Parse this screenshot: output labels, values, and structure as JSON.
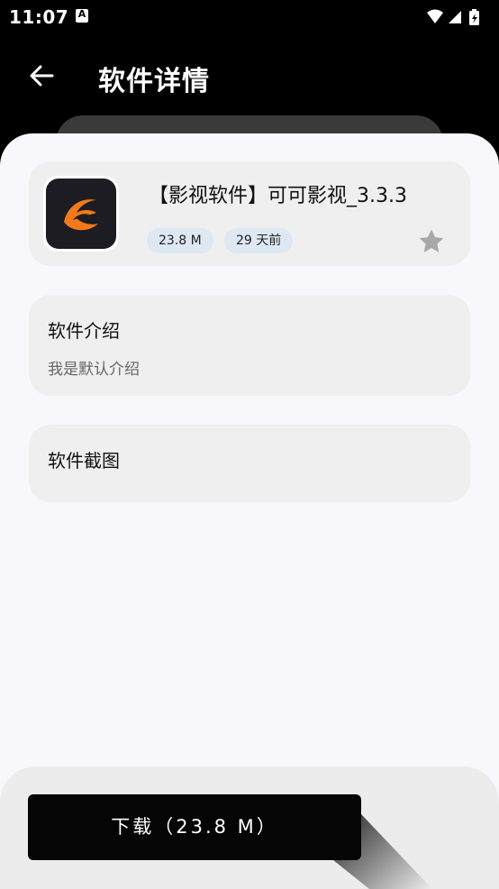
{
  "status_bar": {
    "time": "11:07",
    "notification_icon_letter": "A",
    "icons": [
      "wifi-icon",
      "signal-icon",
      "battery-charging-icon"
    ]
  },
  "header": {
    "title": "软件详情",
    "back_icon": "arrow-left-icon"
  },
  "app": {
    "name": "【影视软件】可可影视_3.3.3",
    "size": "23.8 M",
    "updated": "29 天前",
    "icon": "app-logo-icon",
    "favorite_icon": "star-icon"
  },
  "intro": {
    "title": "软件介绍",
    "text": "我是默认介绍"
  },
  "screenshots": {
    "title": "软件截图"
  },
  "download": {
    "label": "下载（23.8 M）"
  },
  "colors": {
    "accent_orange": "#f27a1a",
    "sheet_bg": "#f8f8fc",
    "card_bg": "#efefef",
    "tag_bg": "#dde8f3"
  }
}
